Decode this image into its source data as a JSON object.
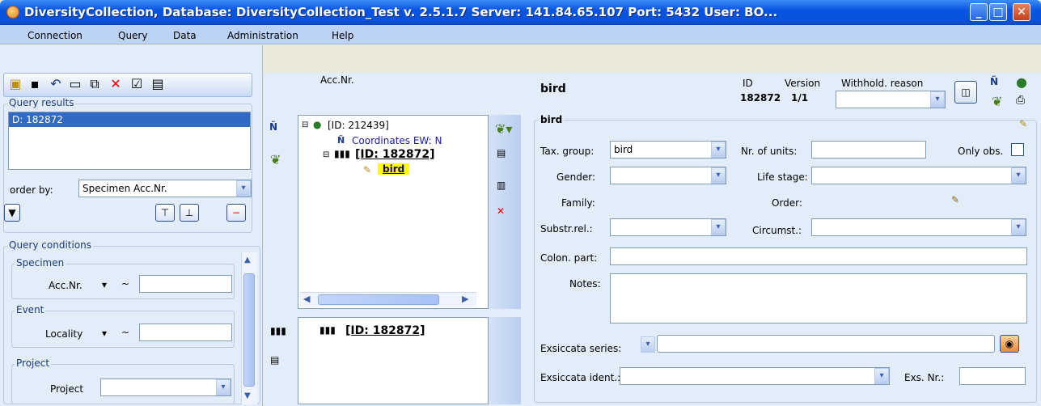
{
  "window": {
    "title": "DiversityCollection,  Database: DiversityCollection_Test   v. 2.5.1.7   Server: 141.84.65.107   Port: 5432   User: BO...",
    "btn_min": "_",
    "btn_max": "□",
    "btn_close": "✕"
  },
  "menu": [
    "Connection",
    "Query",
    "Data",
    "Administration",
    "Help"
  ],
  "left": {
    "query_results_label": "Query results",
    "result_items": [
      "D: 182872"
    ],
    "order_by_label": "order by:",
    "order_by_value": "Specimen Acc.Nr.",
    "query_conditions_label": "Query conditions",
    "specimen_label": "Specimen",
    "acc_nr_label": "Acc.Nr.",
    "tilde": "~",
    "event_label": "Event",
    "locality_label": "Locality",
    "project_group_label": "Project",
    "project_label": "Project"
  },
  "middle": {
    "acc_nr_header": "Acc.Nr.",
    "tree": {
      "event_node": "[ID: 212439]",
      "coord_node": "Coordinates EW: N",
      "specimen_node": "[ID: 182872]",
      "unit_node": "bird"
    },
    "lower_tree_node": "[ID: 182872]"
  },
  "right": {
    "header_title": "bird",
    "id_label": "ID",
    "id_value": "182872",
    "version_label": "Version",
    "version_value": "1/1",
    "withhold_label": "Withhold. reason",
    "group_title": "bird",
    "tax_group_label": "Tax. group:",
    "tax_group_value": "bird",
    "nr_units_label": "Nr. of units:",
    "only_obs_label": "Only obs.",
    "gender_label": "Gender:",
    "life_stage_label": "Life stage:",
    "family_label": "Family:",
    "order_label": "Order:",
    "substr_label": "Substr.rel.:",
    "circumst_label": "Circumst.:",
    "colon_part_label": "Colon. part:",
    "notes_label": "Notes:",
    "exsiccata_series_label": "Exsiccata series:",
    "exsiccata_ident_label": "Exsiccata ident.:",
    "exs_nr_label": "Exs. Nr.:"
  },
  "colors": {
    "titlebar": "#0a54e3",
    "selection": "#316ac5",
    "highlight": "#ffff00"
  }
}
